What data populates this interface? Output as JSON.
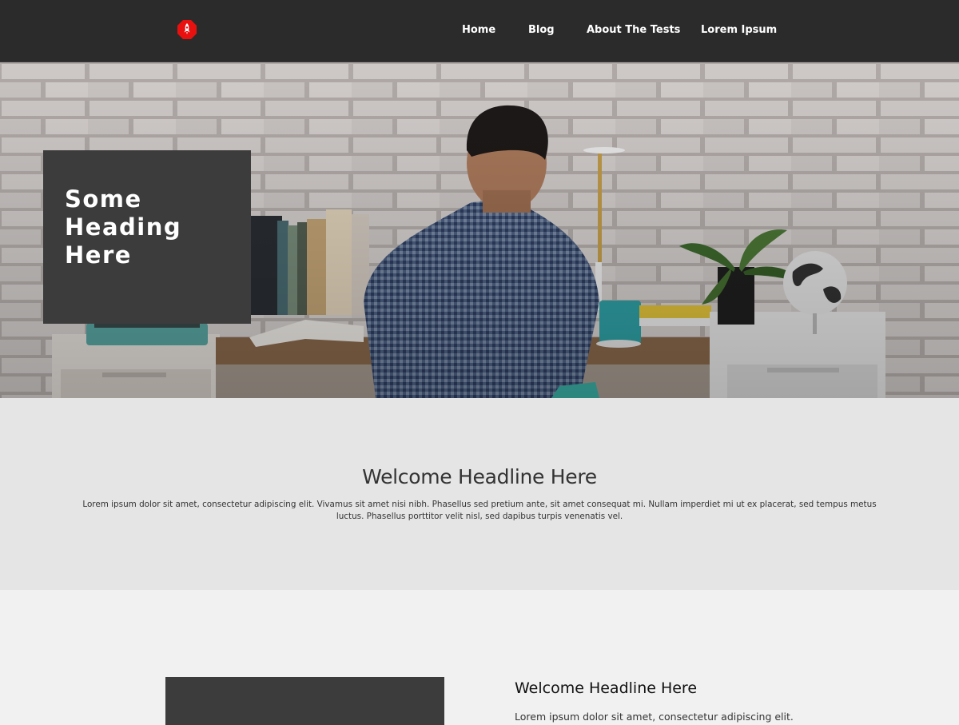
{
  "header": {
    "logo_icon": "rocket-icon",
    "logo_color": "#e8110f",
    "nav": [
      {
        "label": "Home"
      },
      {
        "label": "Blog"
      },
      {
        "label": "About The Tests"
      },
      {
        "label": "Lorem Ipsum"
      }
    ]
  },
  "hero": {
    "heading": "Some Heading Here"
  },
  "welcome": {
    "title": "Welcome Headline Here",
    "text": "Lorem ipsum dolor sit amet, consectetur adipiscing elit. Vivamus sit amet nisi nibh. Phasellus sed pretium ante, sit amet consequat mi. Nullam imperdiet mi ut ex placerat, sed tempus metus luctus. Phasellus porttitor velit nisl, sed dapibus turpis venenatis vel."
  },
  "feature": {
    "title": "Welcome Headline Here",
    "text": "Lorem ipsum dolor sit amet, consectetur adipiscing elit."
  },
  "colors": {
    "header_bg": "#2b2b2b",
    "box_bg": "#3c3c3c",
    "welcome_bg": "#e5e5e5",
    "page_bg": "#f1f1f1"
  }
}
